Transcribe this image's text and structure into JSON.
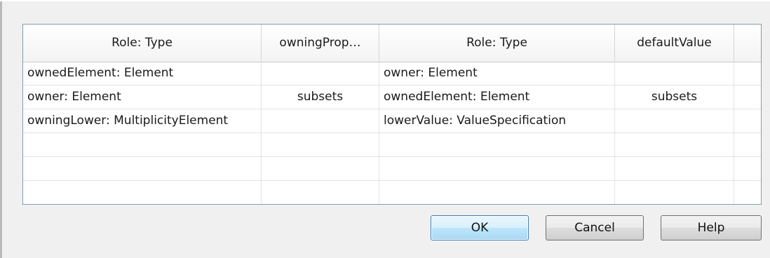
{
  "table": {
    "headers": [
      "Role: Type",
      "owningProp…",
      "Role: Type",
      "defaultValue"
    ],
    "rows": [
      [
        "ownedElement: Element",
        "",
        "owner: Element",
        ""
      ],
      [
        "owner: Element",
        "subsets",
        "ownedElement: Element",
        "subsets"
      ],
      [
        "owningLower: MultiplicityElement",
        "",
        "lowerValue: ValueSpecification",
        ""
      ],
      [
        "",
        "",
        "",
        ""
      ],
      [
        "",
        "",
        "",
        ""
      ],
      [
        "",
        "",
        "",
        ""
      ]
    ]
  },
  "buttons": {
    "ok": "OK",
    "cancel": "Cancel",
    "help": "Help"
  },
  "colors": {
    "dialog_bg": "#f0f0f0",
    "grid_border": "#7f9db9",
    "default_button": "#bee6fd"
  }
}
